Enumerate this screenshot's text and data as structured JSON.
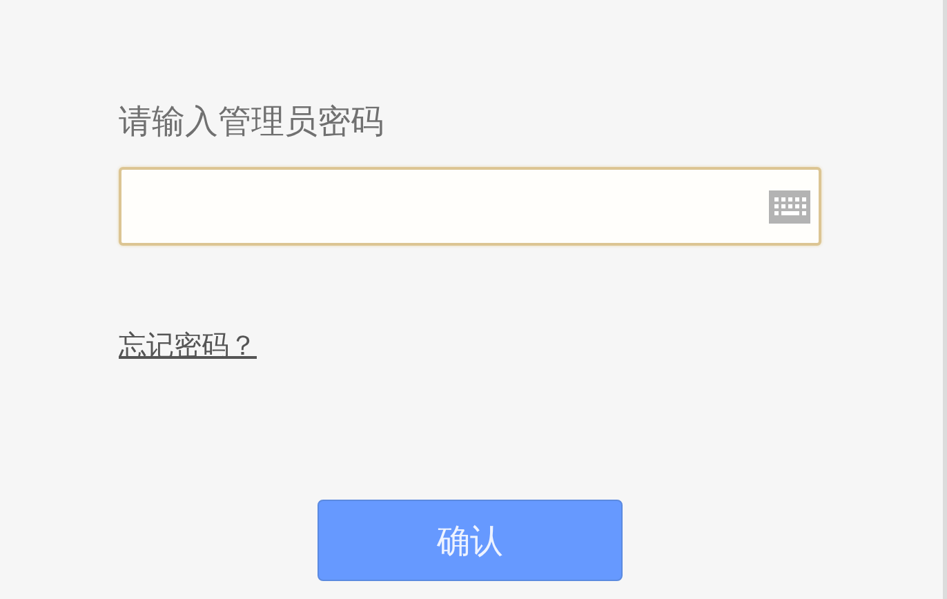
{
  "prompt": "请输入管理员密码",
  "password_field": {
    "focused": true
  },
  "forgot_link": "忘记密码？",
  "confirm_button": "确认"
}
